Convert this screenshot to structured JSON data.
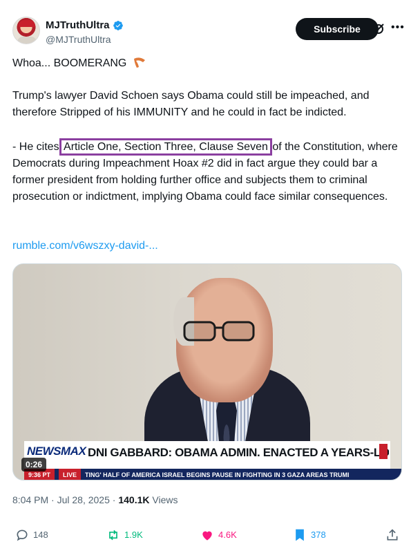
{
  "author": {
    "display_name": "MJTruthUltra",
    "handle": "@MJTruthUltra"
  },
  "header": {
    "subscribe_label": "Subscribe"
  },
  "tweet": {
    "line1": "Whoa... BOOMERANG",
    "para2": "Trump's lawyer David Schoen says Obama could still be impeached, and therefore Stripped of his IMMUNITY and he could in fact be indicted.",
    "para3_before": "- He cites ",
    "para3_highlight": "Article One, Section Three, Clause Seven",
    "para3_after": " of the Constitution, where Democrats during Impeachment Hoax #2 did in fact argue they could bar a former president from holding further office and subjects them to criminal prosecution or indictment, implying Obama could face similar consequences.",
    "link_text": "rumble.com/v6wszxy-david-..."
  },
  "video": {
    "network": "NEWSMAX",
    "headline": "DNI GABBARD: OBAMA ADMIN. ENACTED A YEARS-LONG COUP",
    "ticker_time": "9:36 PT",
    "ticker_live": "LIVE",
    "ticker_text": "TING' HALF OF AMERICA     ISRAEL BEGINS PAUSE IN FIGHTING IN 3 GAZA AREAS     TRUMI",
    "duration": "0:26"
  },
  "meta": {
    "time": "8:04 PM",
    "date": "Jul 28, 2025",
    "views_count": "140.1K",
    "views_label": "Views"
  },
  "actions": {
    "replies": "148",
    "reposts": "1.9K",
    "likes": "4.6K",
    "bookmarks": "378"
  },
  "colors": {
    "accent": "#1d9bf0",
    "repost": "#00ba7c",
    "like": "#f91880",
    "highlight_box": "#8b3fa0"
  }
}
